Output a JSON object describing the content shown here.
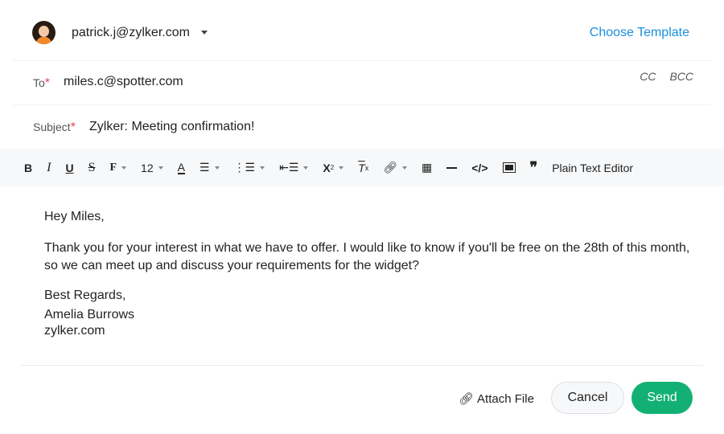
{
  "from": {
    "email": "patrick.j@zylker.com"
  },
  "header": {
    "choose_template": "Choose Template"
  },
  "to": {
    "label": "To",
    "required": "*",
    "value": "miles.c@spotter.com",
    "cc": "CC",
    "bcc": "BCC"
  },
  "subject": {
    "label": "Subject",
    "required": "*",
    "value": "Zylker: Meeting confirmation!"
  },
  "toolbar": {
    "font_size": "12",
    "plain_text": "Plain Text Editor"
  },
  "message": {
    "greeting": "Hey Miles,",
    "paragraph": "Thank you for your interest in what we have to offer. I would like to know if you'll be free on the 28th of this month, so we can meet up and discuss your requirements for the widget?",
    "closing": "Best Regards,",
    "name": "Amelia Burrows",
    "site": "zylker.com"
  },
  "footer": {
    "attach": "Attach File",
    "cancel": "Cancel",
    "send": "Send"
  },
  "colors": {
    "accent": "#1a8fe0",
    "send": "#12b173",
    "required": "#e8425a"
  }
}
